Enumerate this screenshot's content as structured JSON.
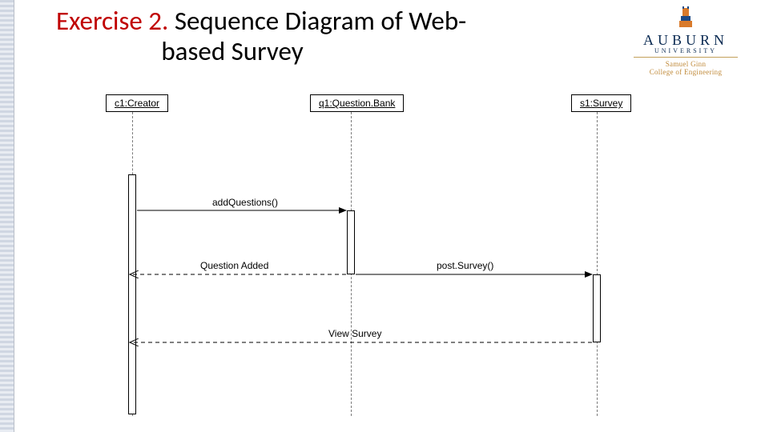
{
  "title": {
    "prefix": "Exercise 2.",
    "rest": " Sequence Diagram of Web-",
    "line2": "based Survey"
  },
  "logo": {
    "name": "AUBURN",
    "subname": "UNIVERSITY",
    "college1": "Samuel Ginn",
    "college2": "College of Engineering"
  },
  "participants": {
    "creator": "c1:Creator",
    "qbank": "q1:Question.Bank",
    "survey": "s1:Survey"
  },
  "messages": {
    "addQuestions": "addQuestions()",
    "questionAdded": "Question Added",
    "postSurvey": "post.Survey()",
    "viewSurvey": "View Survey"
  }
}
